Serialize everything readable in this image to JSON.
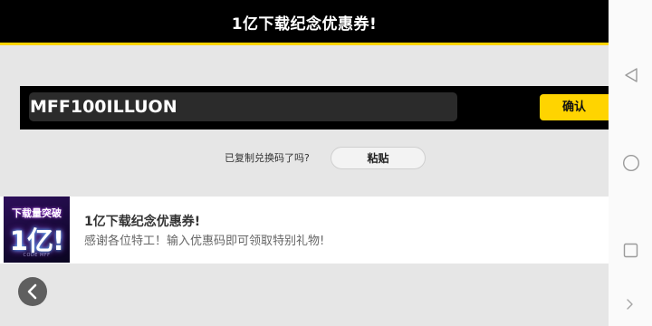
{
  "header": {
    "title": "1亿下载纪念优惠券!"
  },
  "coupon": {
    "code_value": "MFF100ILLUON",
    "confirm_label": "确认"
  },
  "paste": {
    "question": "已复制兑换码了吗?",
    "button_label": "粘贴"
  },
  "event": {
    "banner_top_text": "下载量突破",
    "banner_big_text": "1亿!",
    "banner_small_text": "CODE MFF",
    "title": "1亿下载纪念优惠券!",
    "description": "感谢各位特工！输入优惠码即可领取特别礼物!"
  },
  "navigation": {
    "back_icon": "chevron-left-icon",
    "system_icons": [
      "nav-back-triangle-icon",
      "nav-home-circle-icon",
      "nav-recents-square-icon",
      "nav-expand-chevron-icon"
    ]
  },
  "colors": {
    "accent": "#ffd400",
    "header_bg": "#000000",
    "page_bg": "#e6e6e6"
  }
}
